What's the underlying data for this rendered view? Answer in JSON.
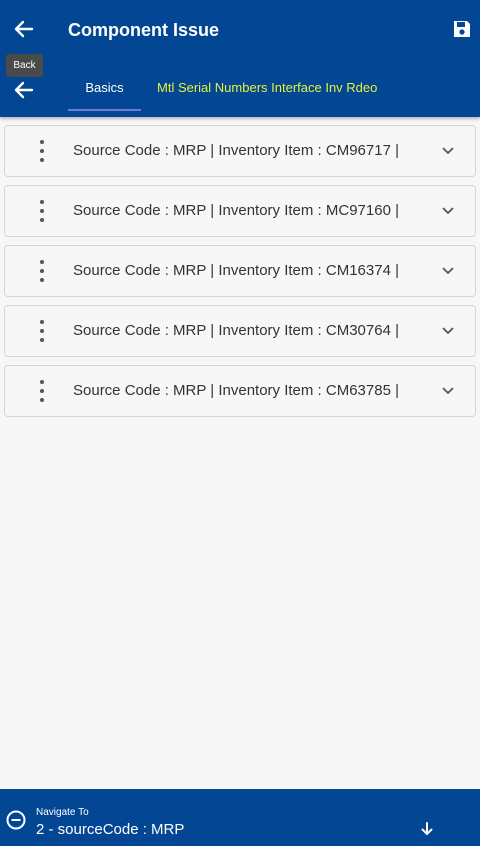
{
  "header": {
    "title": "Component Issue",
    "back_tooltip": "Back"
  },
  "tabs": [
    {
      "label": "Basics",
      "active": true
    },
    {
      "label": "Mtl Serial Numbers Interface Inv Rdeo",
      "active": false
    }
  ],
  "rows": [
    {
      "text": "Source Code  : MRP | Inventory Item  : CM96717 |"
    },
    {
      "text": "Source Code  : MRP | Inventory Item  : MC97160 |"
    },
    {
      "text": "Source Code  : MRP | Inventory Item  : CM16374 |"
    },
    {
      "text": "Source Code  : MRP | Inventory Item  : CM30764 |"
    },
    {
      "text": "Source Code  : MRP | Inventory Item  : CM63785 |"
    }
  ],
  "footer": {
    "navigate_label": "Navigate To",
    "navigate_value": "2 - sourceCode : MRP"
  },
  "colors": {
    "primary": "#034694",
    "tab_active_underline": "#6f7fd0",
    "tab_inactive_text": "#e4f23a"
  },
  "icons": [
    "back-arrow-icon",
    "save-icon",
    "kebab-menu-icon",
    "chevron-down-icon",
    "minus-circle-icon",
    "arrow-down-icon"
  ]
}
